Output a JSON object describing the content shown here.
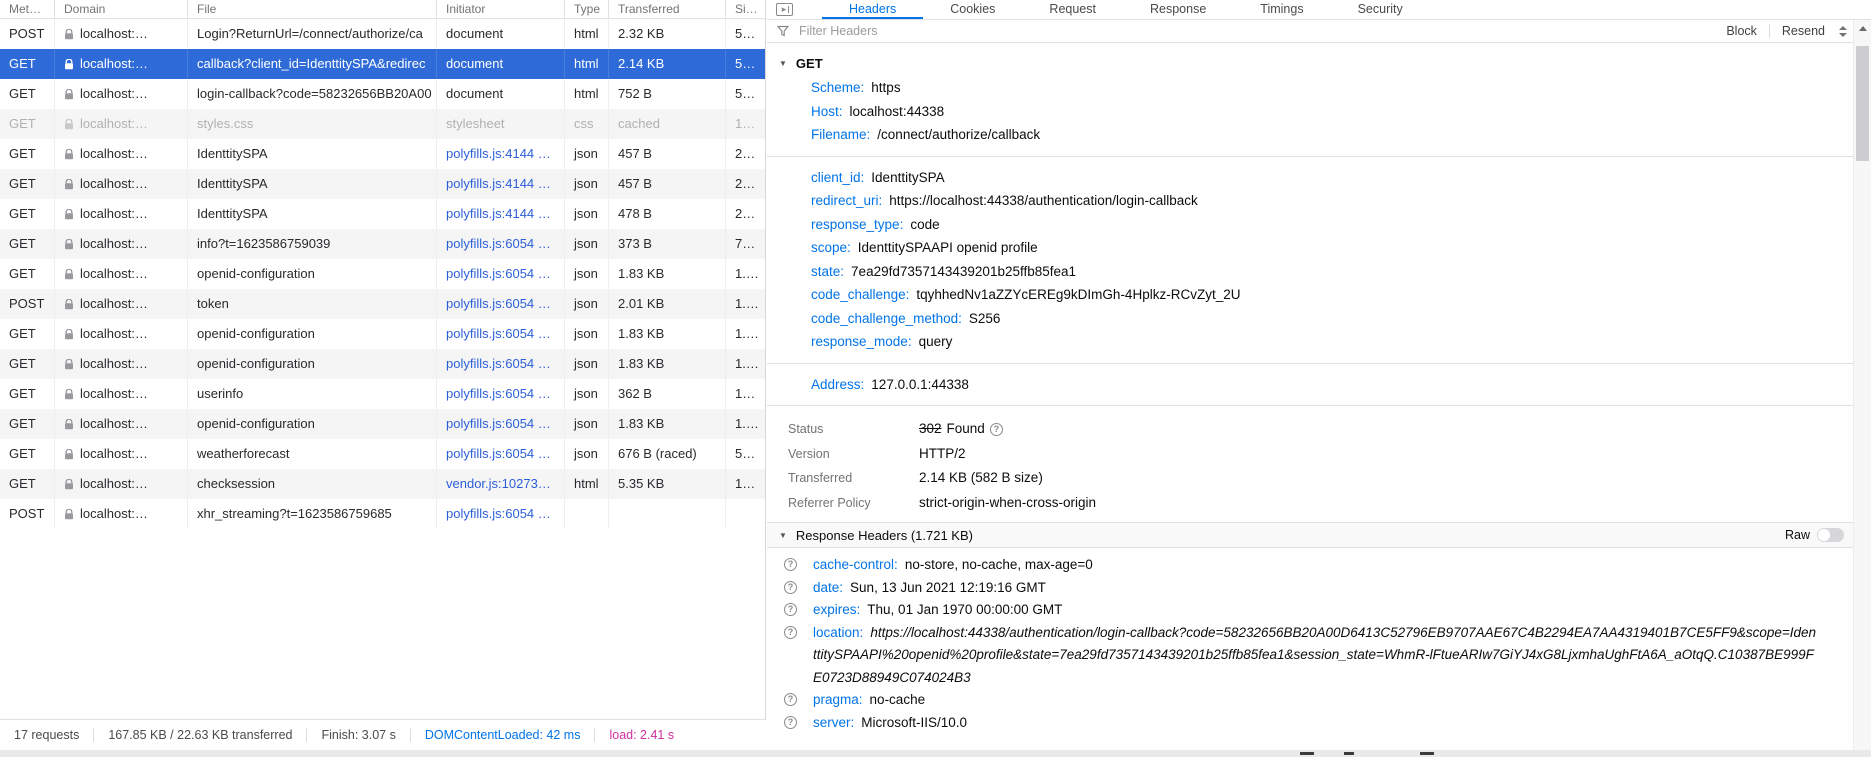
{
  "colors": {
    "selection_blue": "#2F6BD8",
    "accent_blue": "#0074e8",
    "initiator_link_blue": "#2B5FD9",
    "load_magenta": "#D02E9C",
    "dimmed_gray": "#B1B1B3"
  },
  "table": {
    "columns": [
      "Met…",
      "Domain",
      "File",
      "Initiator",
      "Type",
      "Transferred",
      "Si…"
    ],
    "rows": [
      {
        "method": "POST",
        "domain": "localhost:…",
        "file": "Login?ReturnUrl=/connect/authorize/ca",
        "initiator": "document",
        "link": false,
        "type": "html",
        "transferred": "2.32 KB",
        "size": "5…",
        "state": ""
      },
      {
        "method": "GET",
        "domain": "localhost:…",
        "file": "callback?client_id=IdenttitySPA&redirec",
        "initiator": "document",
        "link": false,
        "type": "html",
        "transferred": "2.14 KB",
        "size": "5…",
        "state": "selected"
      },
      {
        "method": "GET",
        "domain": "localhost:…",
        "file": "login-callback?code=58232656BB20A00",
        "initiator": "document",
        "link": false,
        "type": "html",
        "transferred": "752 B",
        "size": "5…",
        "state": ""
      },
      {
        "method": "GET",
        "domain": "localhost:…",
        "file": "styles.css",
        "initiator": "stylesheet",
        "link": false,
        "type": "css",
        "transferred": "cached",
        "size": "1…",
        "state": "dimmed"
      },
      {
        "method": "GET",
        "domain": "localhost:…",
        "file": "IdenttitySPA",
        "initiator": "polyfills.js:4144 …",
        "link": true,
        "type": "json",
        "transferred": "457 B",
        "size": "2…",
        "state": ""
      },
      {
        "method": "GET",
        "domain": "localhost:…",
        "file": "IdenttitySPA",
        "initiator": "polyfills.js:4144 …",
        "link": true,
        "type": "json",
        "transferred": "457 B",
        "size": "2…",
        "state": ""
      },
      {
        "method": "GET",
        "domain": "localhost:…",
        "file": "IdenttitySPA",
        "initiator": "polyfills.js:4144 …",
        "link": true,
        "type": "json",
        "transferred": "478 B",
        "size": "2…",
        "state": ""
      },
      {
        "method": "GET",
        "domain": "localhost:…",
        "file": "info?t=1623586759039",
        "initiator": "polyfills.js:6054 …",
        "link": true,
        "type": "json",
        "transferred": "373 B",
        "size": "7…",
        "state": ""
      },
      {
        "method": "GET",
        "domain": "localhost:…",
        "file": "openid-configuration",
        "initiator": "polyfills.js:6054 …",
        "link": true,
        "type": "json",
        "transferred": "1.83 KB",
        "size": "1.…",
        "state": ""
      },
      {
        "method": "POST",
        "domain": "localhost:…",
        "file": "token",
        "initiator": "polyfills.js:6054 …",
        "link": true,
        "type": "json",
        "transferred": "2.01 KB",
        "size": "1.…",
        "state": ""
      },
      {
        "method": "GET",
        "domain": "localhost:…",
        "file": "openid-configuration",
        "initiator": "polyfills.js:6054 …",
        "link": true,
        "type": "json",
        "transferred": "1.83 KB",
        "size": "1.…",
        "state": ""
      },
      {
        "method": "GET",
        "domain": "localhost:…",
        "file": "openid-configuration",
        "initiator": "polyfills.js:6054 …",
        "link": true,
        "type": "json",
        "transferred": "1.83 KB",
        "size": "1.…",
        "state": ""
      },
      {
        "method": "GET",
        "domain": "localhost:…",
        "file": "userinfo",
        "initiator": "polyfills.js:6054 …",
        "link": true,
        "type": "json",
        "transferred": "362 B",
        "size": "1…",
        "state": ""
      },
      {
        "method": "GET",
        "domain": "localhost:…",
        "file": "openid-configuration",
        "initiator": "polyfills.js:6054 …",
        "link": true,
        "type": "json",
        "transferred": "1.83 KB",
        "size": "1.…",
        "state": ""
      },
      {
        "method": "GET",
        "domain": "localhost:…",
        "file": "weatherforecast",
        "initiator": "polyfills.js:6054 …",
        "link": true,
        "type": "json",
        "transferred": "676 B (raced)",
        "size": "5…",
        "state": ""
      },
      {
        "method": "GET",
        "domain": "localhost:…",
        "file": "checksession",
        "initiator": "vendor.js:10273…",
        "link": true,
        "type": "html",
        "transferred": "5.35 KB",
        "size": "1…",
        "state": ""
      },
      {
        "method": "POST",
        "domain": "localhost:…",
        "file": "xhr_streaming?t=1623586759685",
        "initiator": "polyfills.js:6054 …",
        "link": true,
        "type": "",
        "transferred": "",
        "size": "",
        "state": ""
      }
    ]
  },
  "statusbar": {
    "requests": "17 requests",
    "transferred": "167.85 KB / 22.63 KB transferred",
    "finish": "Finish: 3.07 s",
    "dcl": "DOMContentLoaded: 42 ms",
    "load": "load: 2.41 s"
  },
  "details": {
    "tabs": [
      "Headers",
      "Cookies",
      "Request",
      "Response",
      "Timings",
      "Security"
    ],
    "active_tab": "Headers",
    "filter_placeholder": "Filter Headers",
    "block_label": "Block",
    "resend_label": "Resend",
    "request": {
      "method": "GET",
      "url_rows": [
        {
          "k": "Scheme",
          "v": "https"
        },
        {
          "k": "Host",
          "v": "localhost:44338"
        },
        {
          "k": "Filename",
          "v": "/connect/authorize/callback"
        }
      ],
      "query_rows": [
        {
          "k": "client_id",
          "v": "IdenttitySPA"
        },
        {
          "k": "redirect_uri",
          "v": "https://localhost:44338/authentication/login-callback"
        },
        {
          "k": "response_type",
          "v": "code"
        },
        {
          "k": "scope",
          "v": "IdenttitySPAAPI openid profile"
        },
        {
          "k": "state",
          "v": "7ea29fd7357143439201b25ffb85fea1"
        },
        {
          "k": "code_challenge",
          "v": "tqyhhedNv1aZZYcEREg9kDImGh-4Hplkz-RCvZyt_2U"
        },
        {
          "k": "code_challenge_method",
          "v": "S256"
        },
        {
          "k": "response_mode",
          "v": "query"
        }
      ],
      "address": {
        "k": "Address",
        "v": "127.0.0.1:44338"
      }
    },
    "summary": {
      "status_label": "Status",
      "status_code": "302",
      "status_text": "Found",
      "version_label": "Version",
      "version": "HTTP/2",
      "transferred_label": "Transferred",
      "transferred": "2.14 KB (582 B size)",
      "referrer_label": "Referrer Policy",
      "referrer": "strict-origin-when-cross-origin"
    },
    "response_headers": {
      "title": "Response Headers (1.721 KB)",
      "raw_label": "Raw",
      "items": [
        {
          "k": "cache-control",
          "v": "no-store, no-cache, max-age=0",
          "italic": false
        },
        {
          "k": "date",
          "v": "Sun, 13 Jun 2021 12:19:16 GMT",
          "italic": false
        },
        {
          "k": "expires",
          "v": "Thu, 01 Jan 1970 00:00:00 GMT",
          "italic": false
        },
        {
          "k": "location",
          "v": "https://localhost:44338/authentication/login-callback?code=58232656BB20A00D6413C52796EB9707AAE67C4B2294EA7AA4319401B7CE5FF9&scope=IdenttitySPAAPI%20openid%20profile&state=7ea29fd7357143439201b25ffb85fea1&session_state=WhmR-lFtueARIw7GiYJ4xG8LjxmhaUghFtA6A_aOtqQ.C10387BE999FE0723D88949C074024B3",
          "italic": true
        },
        {
          "k": "pragma",
          "v": "no-cache",
          "italic": false
        },
        {
          "k": "server",
          "v": "Microsoft-IIS/10.0",
          "italic": false
        }
      ]
    }
  }
}
